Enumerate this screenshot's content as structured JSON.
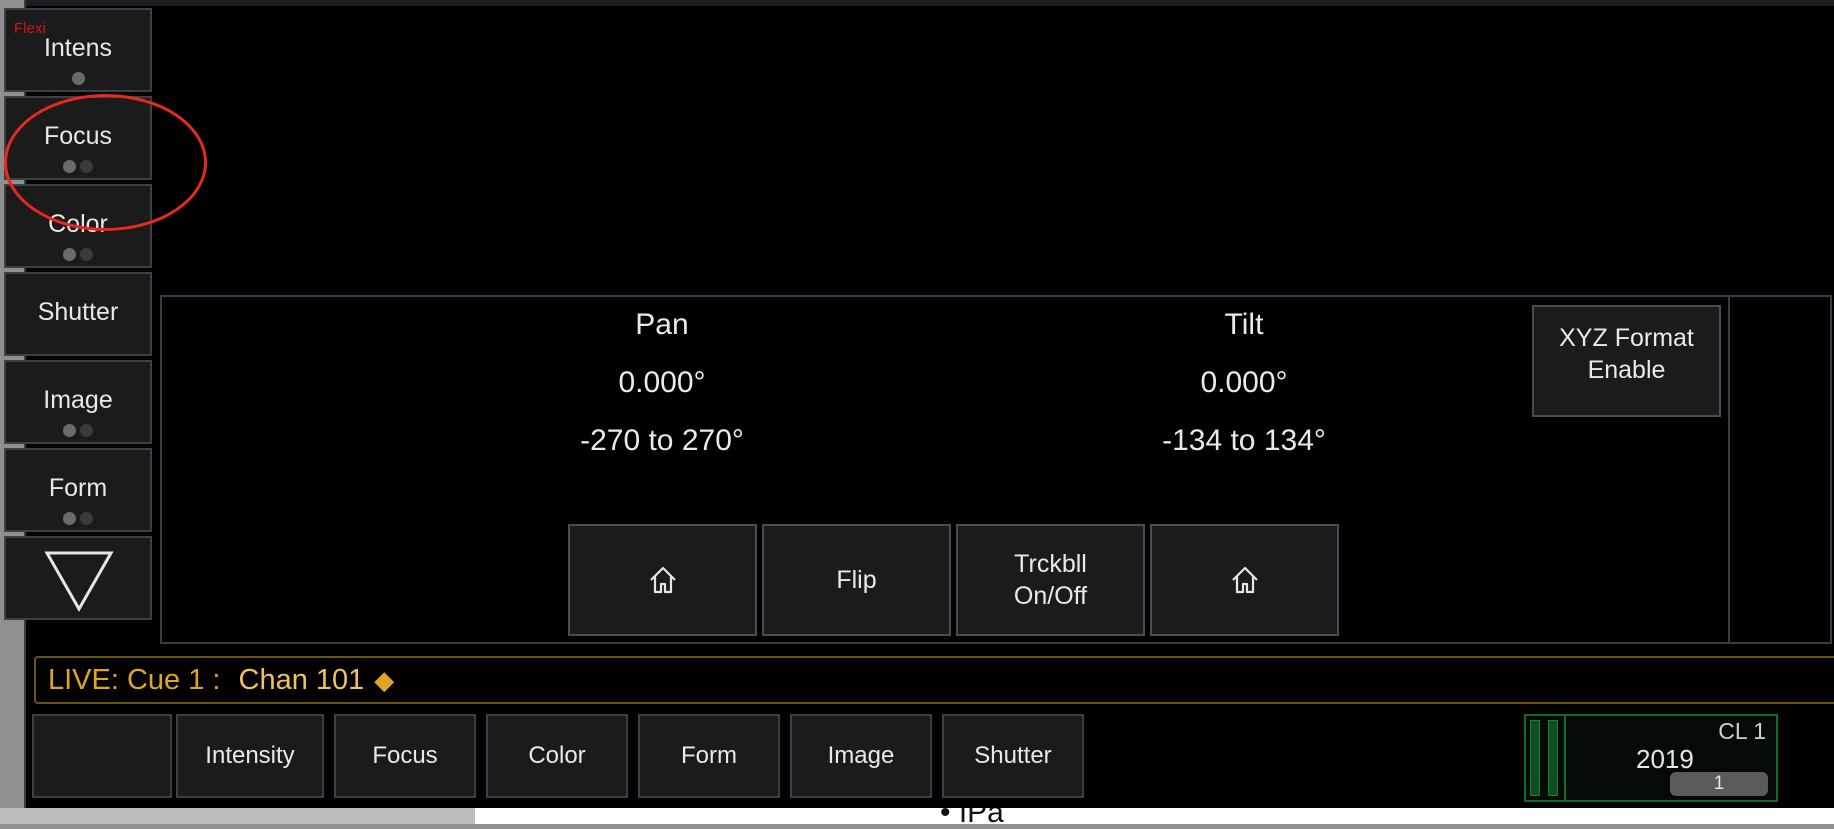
{
  "flexi_label": "Flexi",
  "categories": [
    {
      "label": "Intens",
      "dots": 1
    },
    {
      "label": "Focus",
      "dots": 2
    },
    {
      "label": "Color",
      "dots": 2
    },
    {
      "label": "Shutter",
      "dots": 0
    },
    {
      "label": "Image",
      "dots": 2
    },
    {
      "label": "Form",
      "dots": 2
    }
  ],
  "pan": {
    "name": "Pan",
    "value": "0.000°",
    "range": "-270 to 270°"
  },
  "tilt": {
    "name": "Tilt",
    "value": "0.000°",
    "range": "-134 to 134°"
  },
  "xyz_button": {
    "line1": "XYZ Format",
    "line2": "Enable"
  },
  "actions": {
    "flip": "Flip",
    "trackball_line1": "Trckbll",
    "trackball_line2": "On/Off",
    "home_icon_left": "home-icon",
    "home_icon_right": "home-icon"
  },
  "command_line": {
    "mode": "LIVE: Cue  1 :",
    "target": "Chan 101",
    "marker": "◆"
  },
  "tabs": [
    "Intensity",
    "Focus",
    "Color",
    "Form",
    "Image",
    "Shutter"
  ],
  "cue_list": {
    "label": "CL 1",
    "number": "2019",
    "pill": "1"
  },
  "stray_text": "• IPa",
  "colors": {
    "accent": "#e1a526",
    "highlight_circle": "#e8291d",
    "cuelist_green": "#0f6a2d"
  }
}
